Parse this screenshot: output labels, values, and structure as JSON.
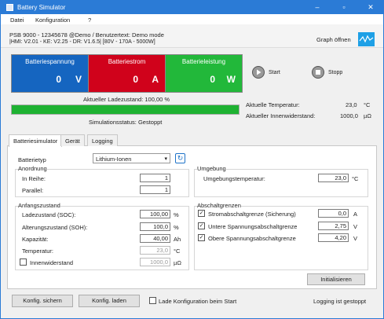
{
  "window": {
    "title": "Battery Simulator"
  },
  "menu": [
    "Datei",
    "Konfiguration",
    "?"
  ],
  "info": {
    "line1": "PSB 9000 - 12345678 @Demo / Benutzertext: Demo mode",
    "line2": "|HMI: V2.01 - KE: V2.25 - DR: V1.6.5| [80V - 170A - 5000W]",
    "graph_link": "Graph öffnen"
  },
  "panels": {
    "voltage": {
      "label": "Batteriespannung",
      "value": "0",
      "unit": "V",
      "color": "#1565c0"
    },
    "current": {
      "label": "Batteriestrom",
      "value": "0",
      "unit": "A",
      "color": "#d0021b"
    },
    "power": {
      "label": "Batterieleistung",
      "value": "0",
      "unit": "W",
      "color": "#22b83a"
    }
  },
  "controls": {
    "start": "Start",
    "stop": "Stopp"
  },
  "status": {
    "soc_label": "Aktueller Ladezustand: 100,00 %",
    "soc_fraction": 1.0,
    "sim_status": "Simulationsstatus: Gestoppt",
    "temp_label": "Aktuelle Temperatur:",
    "temp_value": "23,0",
    "temp_unit": "°C",
    "ir_label": "Aktueller Innenwiderstand:",
    "ir_value": "1000,0",
    "ir_unit": "µΩ"
  },
  "tabs": [
    "Batteriesimulator",
    "Gerät",
    "Logging"
  ],
  "battery_type": {
    "label": "Batterietyp",
    "value": "Lithium-Ionen"
  },
  "arrangement": {
    "title": "Anordnung",
    "series_label": "In Reihe:",
    "series_value": "1",
    "parallel_label": "Parallel:",
    "parallel_value": "1"
  },
  "environment": {
    "title": "Umgebung",
    "temp_label": "Umgebungstemperatur:",
    "temp_value": "23,0",
    "temp_unit": "°C"
  },
  "initial": {
    "title": "Anfangszustand",
    "soc_label": "Ladezustand (SOC):",
    "soc_value": "100,00",
    "soc_unit": "%",
    "soh_label": "Alterungszustand (SOH):",
    "soh_value": "100,0",
    "soh_unit": "%",
    "cap_label": "Kapazität:",
    "cap_value": "40,00",
    "cap_unit": "Ah",
    "temp_label": "Temperatur:",
    "temp_value": "23,0",
    "temp_unit": "°C",
    "ir_label": "Innenwiderstand",
    "ir_value": "1000,0",
    "ir_unit": "µΩ"
  },
  "limits": {
    "title": "Abschaltgrenzen",
    "current_label": "Stromabschaltgrenze (Sicherung)",
    "current_value": "0,0",
    "current_unit": "A",
    "lower_label": "Untere Spannungsabschaltgrenze",
    "lower_value": "2,75",
    "lower_unit": "V",
    "upper_label": "Obere Spannungsabschaltgrenze",
    "upper_value": "4,20",
    "upper_unit": "V"
  },
  "buttons": {
    "init": "Initialisieren",
    "save": "Konfig. sichern",
    "load": "Konfig. laden"
  },
  "footer": {
    "autoload_label": "Lade Konfiguration beim Start",
    "logging_status": "Logging ist gestoppt"
  }
}
